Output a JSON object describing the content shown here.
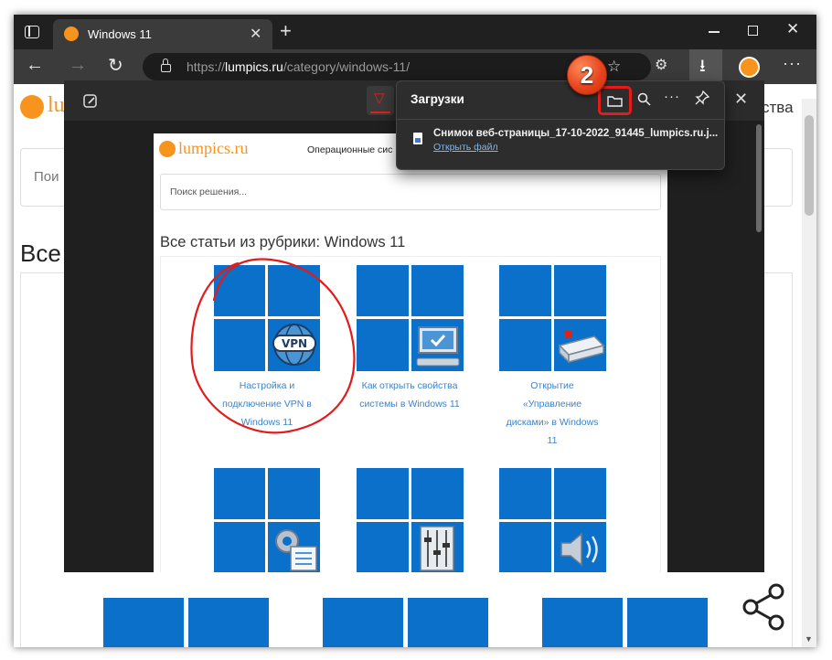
{
  "browser": {
    "tab_title": "Windows 11",
    "url": "https://lumpics.ru/category/windows-11/",
    "url_prefix": "https://",
    "url_domain": "lumpics.ru",
    "url_path": "/category/windows-11/"
  },
  "underlying_page": {
    "logo_fragment": "lu",
    "search_fragment": "Пои",
    "heading_fragment": "Все",
    "nav_fragment": "ства"
  },
  "screenshot_page": {
    "logo_text": "lumpics.ru",
    "nav_text": "Операционные сис",
    "search_placeholder": "Поиск решения...",
    "heading": "Все статьи из рубрики: Windows 11",
    "articles": [
      {
        "title": [
          "Настройка и",
          "подключение VPN в",
          "Windows 11"
        ]
      },
      {
        "title": [
          "Как открыть свойства",
          "системы в Windows 11"
        ]
      },
      {
        "title": [
          "Открытие",
          "«Управление",
          "дисками» в Windows",
          "11"
        ]
      }
    ],
    "vpn_badge": "VPN"
  },
  "downloads": {
    "title": "Загрузки",
    "file_name": "Снимок веб-страницы_17-10-2022_91445_lumpics.ru.j...",
    "open_link": "Открыть файл"
  },
  "annotation": {
    "step_number": "2",
    "badge_color": "#e8451e",
    "highlight_color": "#e21b1b"
  },
  "colors": {
    "tile_blue": "#0a70c9",
    "brand_orange": "#f7941d",
    "link_blue": "#3f83c5"
  },
  "icons": [
    "sidebar-icon",
    "orange-favicon",
    "close-icon",
    "plus-icon",
    "back-arrow-icon",
    "forward-arrow-icon",
    "refresh-icon",
    "lock-icon",
    "favorite-add-icon",
    "extensions-icon",
    "download-icon",
    "profile-avatar",
    "more-icon",
    "minimize-icon",
    "maximize-icon",
    "window-close-icon",
    "annotate-icon",
    "folder-icon",
    "search-icon",
    "pin-icon",
    "share-icon"
  ]
}
